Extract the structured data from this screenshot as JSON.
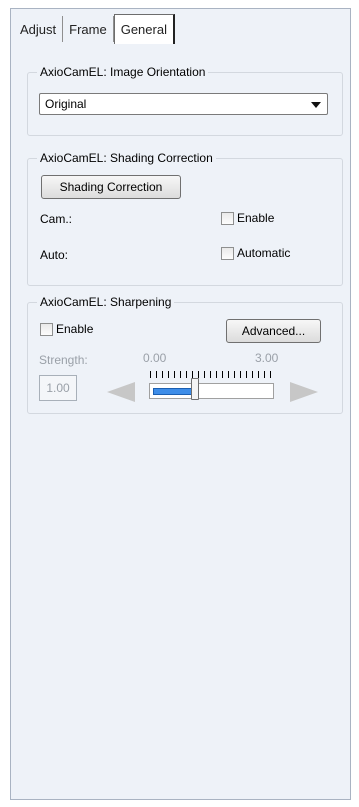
{
  "tabs": [
    {
      "label": "Adjust",
      "active": false
    },
    {
      "label": "Frame",
      "active": false
    },
    {
      "label": "General",
      "active": true
    }
  ],
  "orientation": {
    "title": "AxioCamEL: Image Orientation",
    "selected": "Original"
  },
  "shading": {
    "title": "AxioCamEL: Shading Correction",
    "button_label": "Shading Correction",
    "cam_label": "Cam.:",
    "cam_checkbox_label": "Enable",
    "cam_checked": false,
    "auto_label": "Auto:",
    "auto_checkbox_label": "Automatic",
    "auto_checked": false
  },
  "sharpening": {
    "title": "AxioCamEL: Sharpening",
    "enable_label": "Enable",
    "enable_checked": false,
    "advanced_label": "Advanced...",
    "strength_label": "Strength:",
    "strength_value": "1.00",
    "range_min": "0.00",
    "range_max": "3.00",
    "slider_fraction": 0.33
  },
  "colors": {
    "panel_bg": "#eef2f8",
    "slider_fill": "#3e8de8",
    "disabled_text": "#9aa0a8"
  }
}
